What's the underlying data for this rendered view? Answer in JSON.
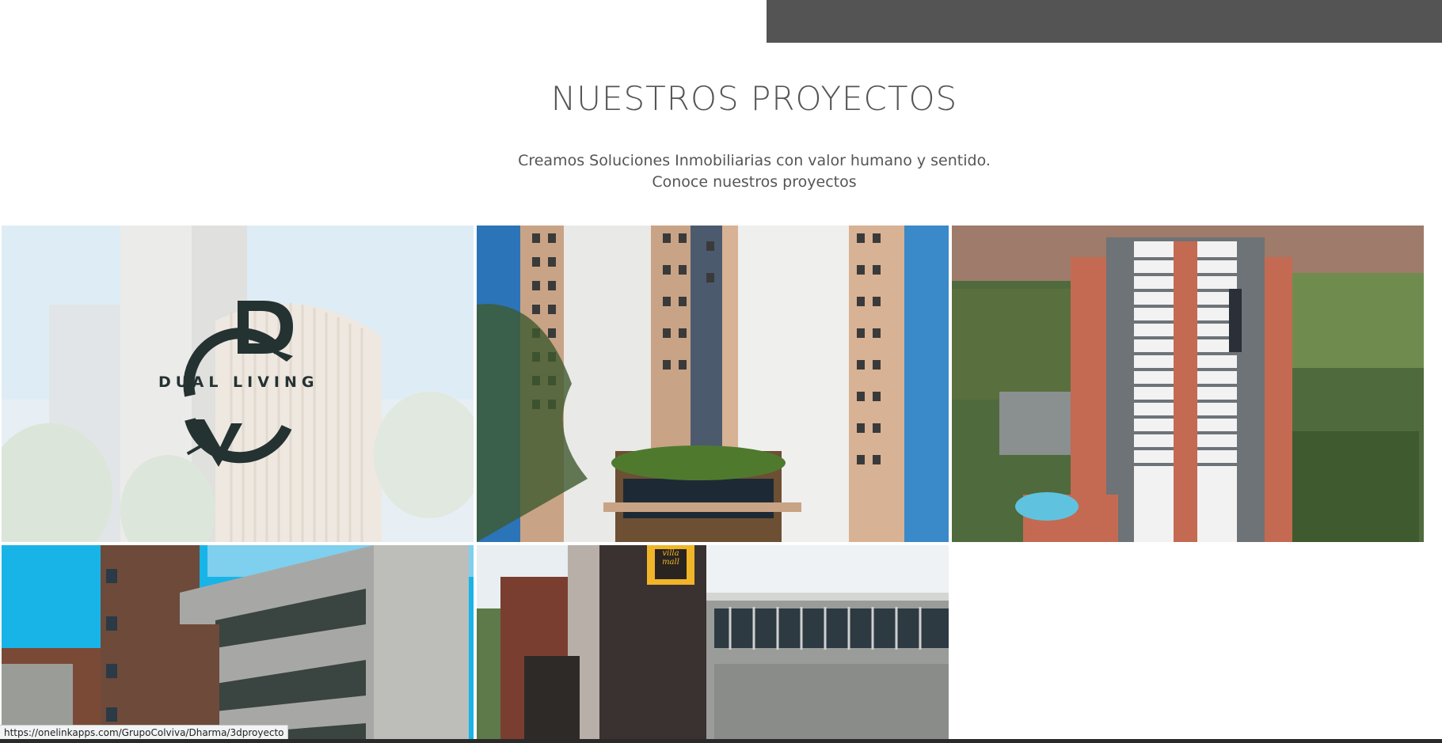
{
  "section": {
    "title": "NUESTROS PROYECTOS",
    "subtitle_line1": "Creamos Soluciones Inmobiliarias con valor humano y sentido.",
    "subtitle_line2": "Conoce nuestros proyectos"
  },
  "projects": [
    {
      "logo_text": "DUAL LIVING"
    },
    {},
    {},
    {},
    {
      "sign_text": "villa mall"
    }
  ],
  "status_bar": {
    "url": "https://onelinkapps.com/GrupoColviva/Dharma/3dproyecto"
  },
  "colors": {
    "header_bar": "#545454",
    "title_text": "#555555",
    "logo_dark": "#243232"
  }
}
